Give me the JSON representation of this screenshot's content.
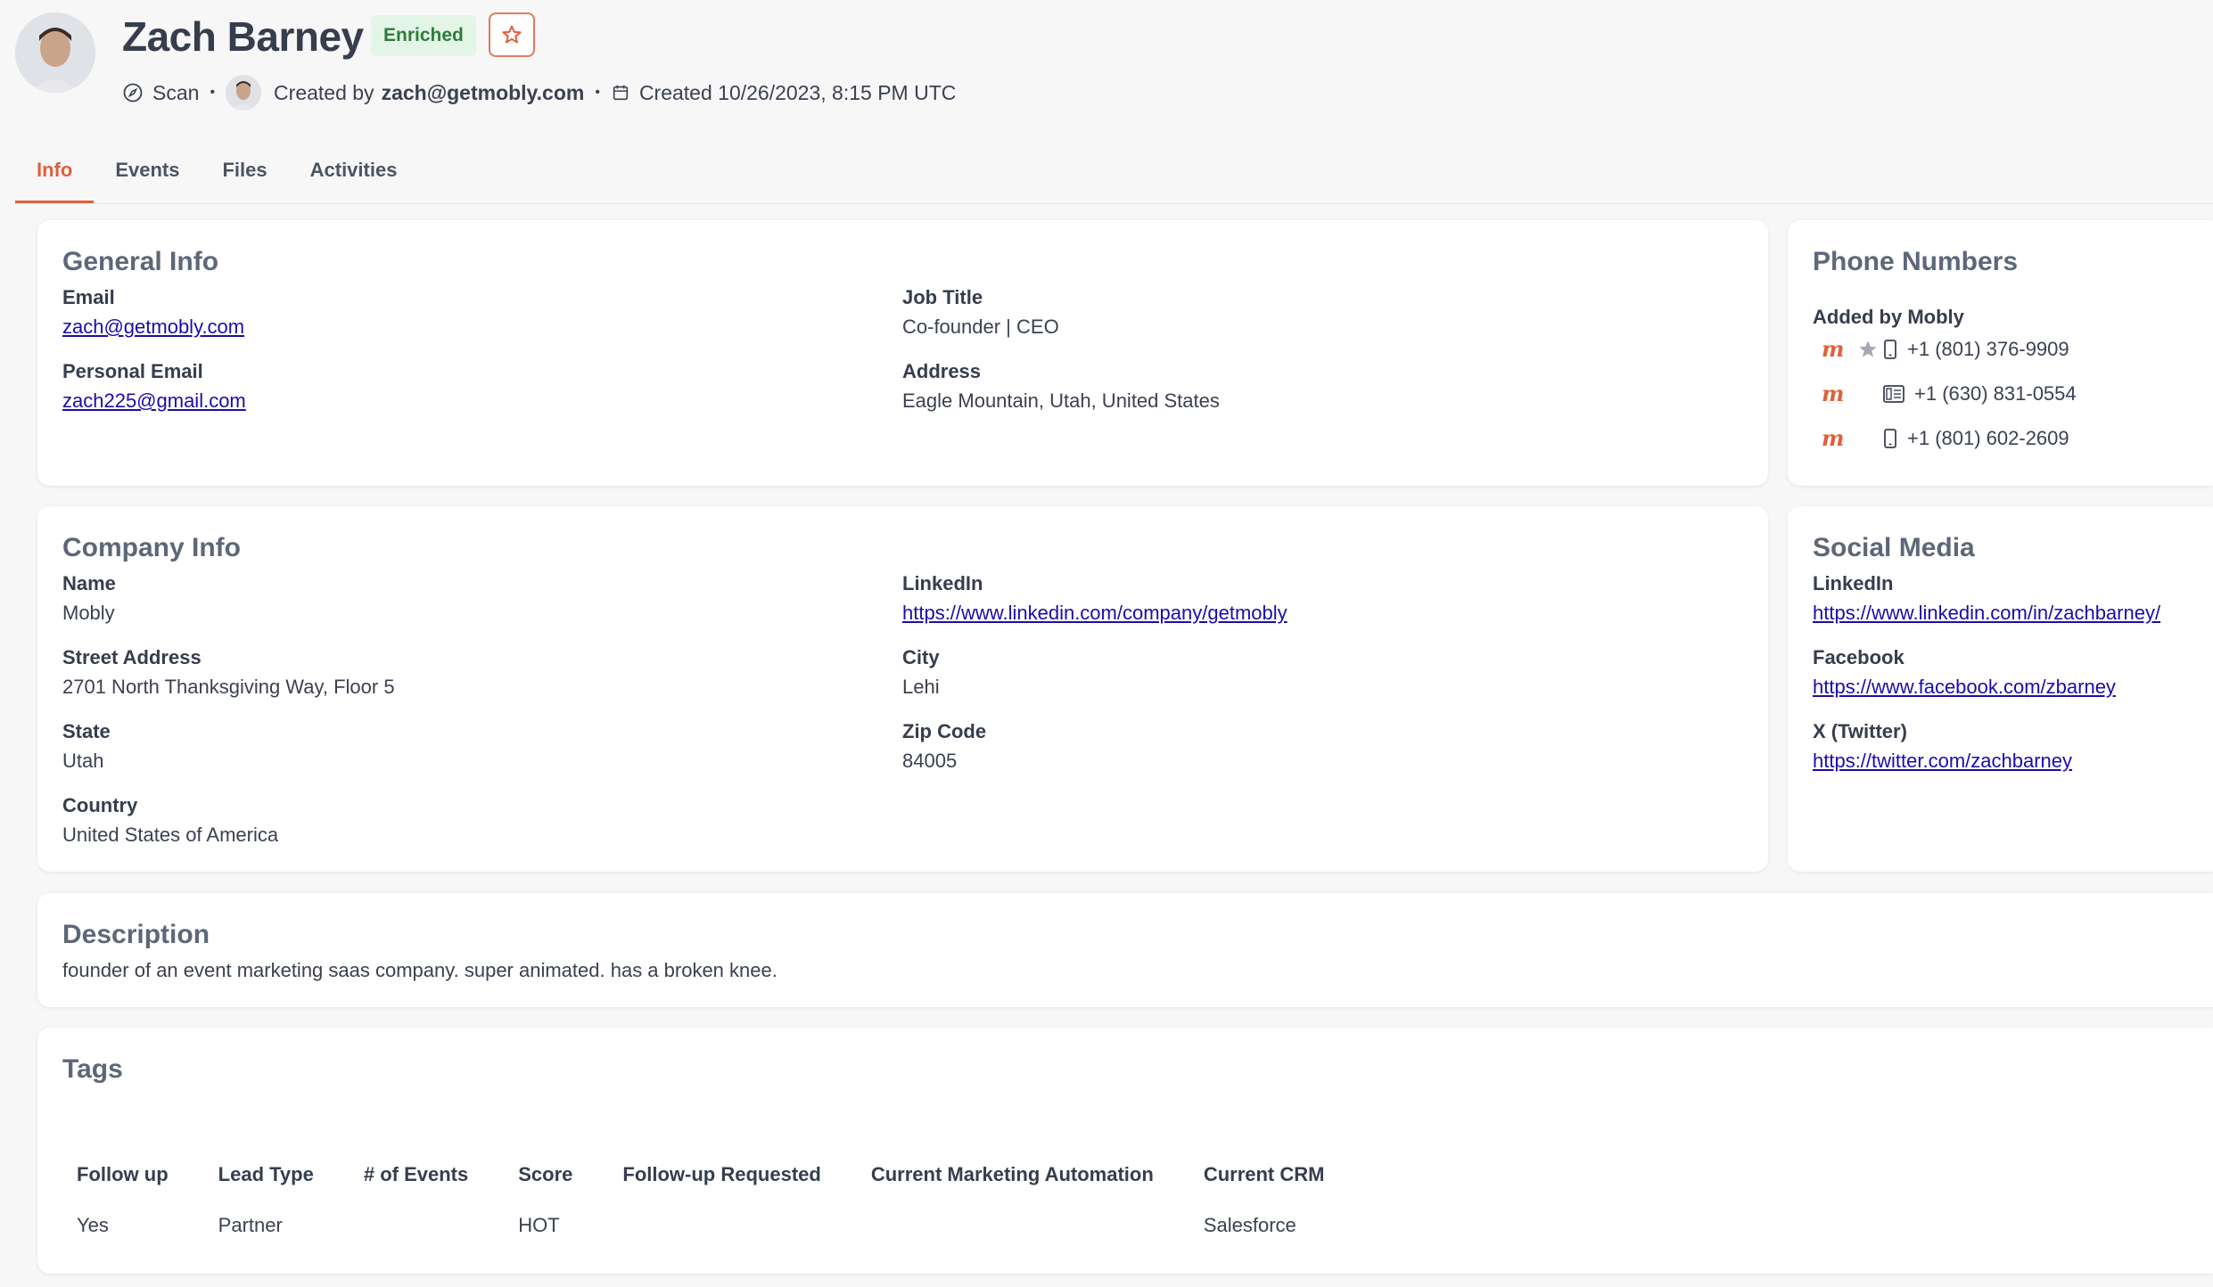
{
  "contact": {
    "name": "Zach Barney",
    "badge": "Enriched",
    "source": "Scan",
    "created_by_prefix": "Created by",
    "created_by": "zach@getmobly.com",
    "created_at": "Created 10/26/2023, 8:15 PM UTC"
  },
  "tabs": [
    {
      "label": "Info",
      "active": true
    },
    {
      "label": "Events"
    },
    {
      "label": "Files"
    },
    {
      "label": "Activities"
    }
  ],
  "general": {
    "title": "General Info",
    "email_label": "Email",
    "email": "zach@getmobly.com",
    "personal_email_label": "Personal Email",
    "personal_email": "zach225@gmail.com",
    "job_title_label": "Job Title",
    "job_title": "Co-founder | CEO",
    "address_label": "Address",
    "address": "Eagle Mountain, Utah, United States"
  },
  "phones": {
    "title": "Phone Numbers",
    "group_label": "Added by Mobly",
    "items": [
      {
        "number": "+1 (801) 376-9909",
        "type": "mobile-icon",
        "starred": true
      },
      {
        "number": "+1 (630) 831-0554",
        "type": "office-phone-icon",
        "starred": false
      },
      {
        "number": "+1 (801) 602-2609",
        "type": "mobile-icon",
        "starred": false
      }
    ]
  },
  "company": {
    "title": "Company Info",
    "name_label": "Name",
    "name": "Mobly",
    "street_label": "Street Address",
    "street": "2701 North Thanksgiving Way, Floor 5",
    "state_label": "State",
    "state": "Utah",
    "country_label": "Country",
    "country": "United States of America",
    "linkedin_label": "LinkedIn",
    "linkedin": "https://www.linkedin.com/company/getmobly",
    "city_label": "City",
    "city": "Lehi",
    "zip_label": "Zip Code",
    "zip": "84005"
  },
  "social": {
    "title": "Social Media",
    "linkedin_label": "LinkedIn",
    "linkedin": "https://www.linkedin.com/in/zachbarney/",
    "facebook_label": "Facebook",
    "facebook": "https://www.facebook.com/zbarney",
    "twitter_label": "X (Twitter)",
    "twitter": "https://twitter.com/zachbarney"
  },
  "description": {
    "title": "Description",
    "text": "founder of an event marketing saas company. super animated. has a broken knee."
  },
  "tags": {
    "title": "Tags",
    "headers": [
      "Follow up",
      "Lead Type",
      "# of Events",
      "Score",
      "Follow-up Requested",
      "Current Marketing Automation",
      "Current CRM"
    ],
    "values": [
      "Yes",
      "Partner",
      "",
      "HOT",
      "",
      "",
      "Salesforce"
    ]
  },
  "colors": {
    "accent": "#e0603c",
    "badge_bg": "#e3f5e6",
    "badge_text": "#2e7d3a",
    "link": "#1a0dab"
  }
}
